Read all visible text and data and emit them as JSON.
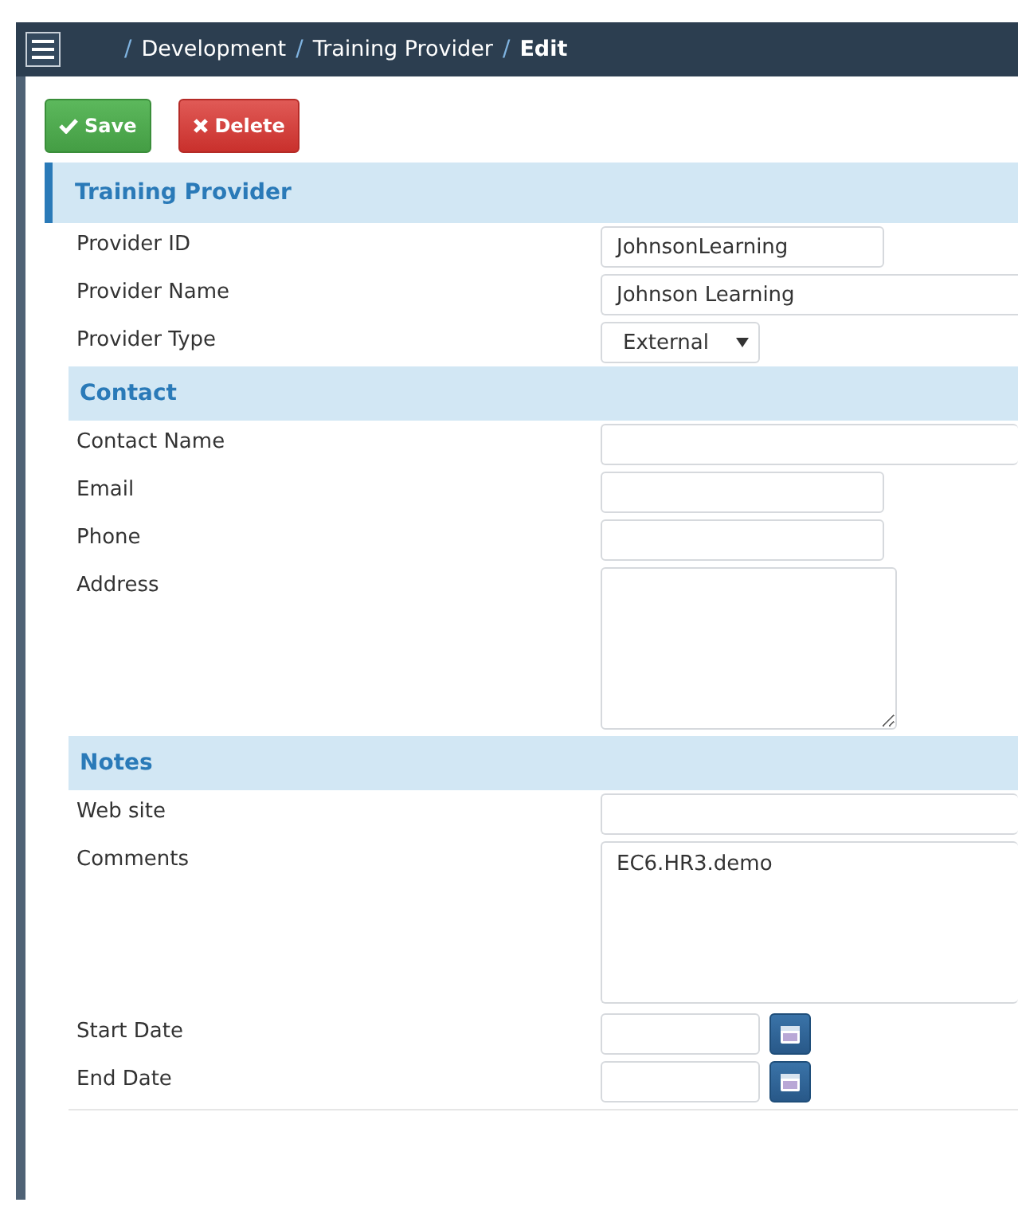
{
  "header": {
    "breadcrumb": [
      {
        "sep": "/",
        "label": "Development",
        "current": false
      },
      {
        "sep": "/",
        "label": "Training Provider",
        "current": false
      },
      {
        "sep": "/",
        "label": "Edit",
        "current": true
      }
    ]
  },
  "buttons": [
    {
      "kind": "save",
      "label": "Save"
    },
    {
      "kind": "delete",
      "label": "Delete"
    }
  ],
  "panel": {
    "title": "Training Provider",
    "groups": [
      {
        "fields": [
          {
            "label": "Provider ID",
            "kind": "text",
            "wide": false,
            "value": "JohnsonLearning"
          },
          {
            "label": "Provider Name",
            "kind": "text",
            "wide": true,
            "value": "Johnson Learning"
          },
          {
            "label": "Provider Type",
            "kind": "select",
            "value": "External"
          }
        ]
      },
      {
        "title": "Contact",
        "fields": [
          {
            "label": "Contact Name",
            "kind": "text",
            "wide": true
          },
          {
            "label": "Email",
            "kind": "text",
            "wide": false
          },
          {
            "label": "Phone",
            "kind": "text",
            "wide": false
          },
          {
            "label": "Address",
            "kind": "textarea",
            "wide": false
          }
        ]
      },
      {
        "title": "Notes",
        "fields": [
          {
            "label": "Web site",
            "kind": "text",
            "wide": true
          },
          {
            "label": "Comments",
            "kind": "textarea",
            "wide": true,
            "value": "EC6.HR3.demo"
          },
          {
            "label": "Start Date",
            "kind": "date"
          },
          {
            "label": "End Date",
            "kind": "date"
          }
        ]
      }
    ]
  }
}
